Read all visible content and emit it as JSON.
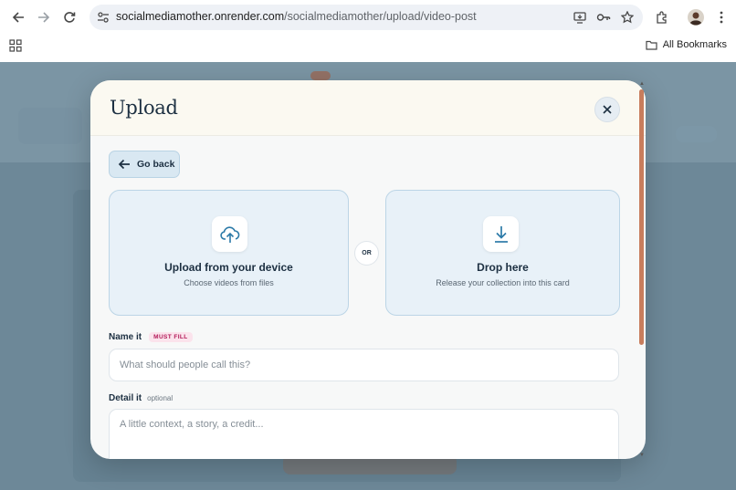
{
  "browser": {
    "url_host": "socialmediamother.onrender.com",
    "url_path": "/socialmediamother/upload/video-post",
    "bookmarks_label": "All Bookmarks"
  },
  "modal": {
    "title": "Upload",
    "back_label": "Go back",
    "upload_card": {
      "title": "Upload from your device",
      "subtitle": "Choose videos from files",
      "icon": "cloud-upload-icon"
    },
    "or_label": "OR",
    "drop_card": {
      "title": "Drop here",
      "subtitle": "Release your collection into this card",
      "icon": "download-icon"
    },
    "name_field": {
      "label": "Name it",
      "tag": "MUST FILL",
      "placeholder": "What should people call this?",
      "value": ""
    },
    "detail_field": {
      "label": "Detail it",
      "tag": "optional",
      "placeholder": "A little context, a story, a credit...",
      "value": ""
    }
  },
  "colors": {
    "accent": "#2c7aa8",
    "title": "#1d3042",
    "required_tag": "#b31a58",
    "scrollbar": "#c87d5c"
  }
}
